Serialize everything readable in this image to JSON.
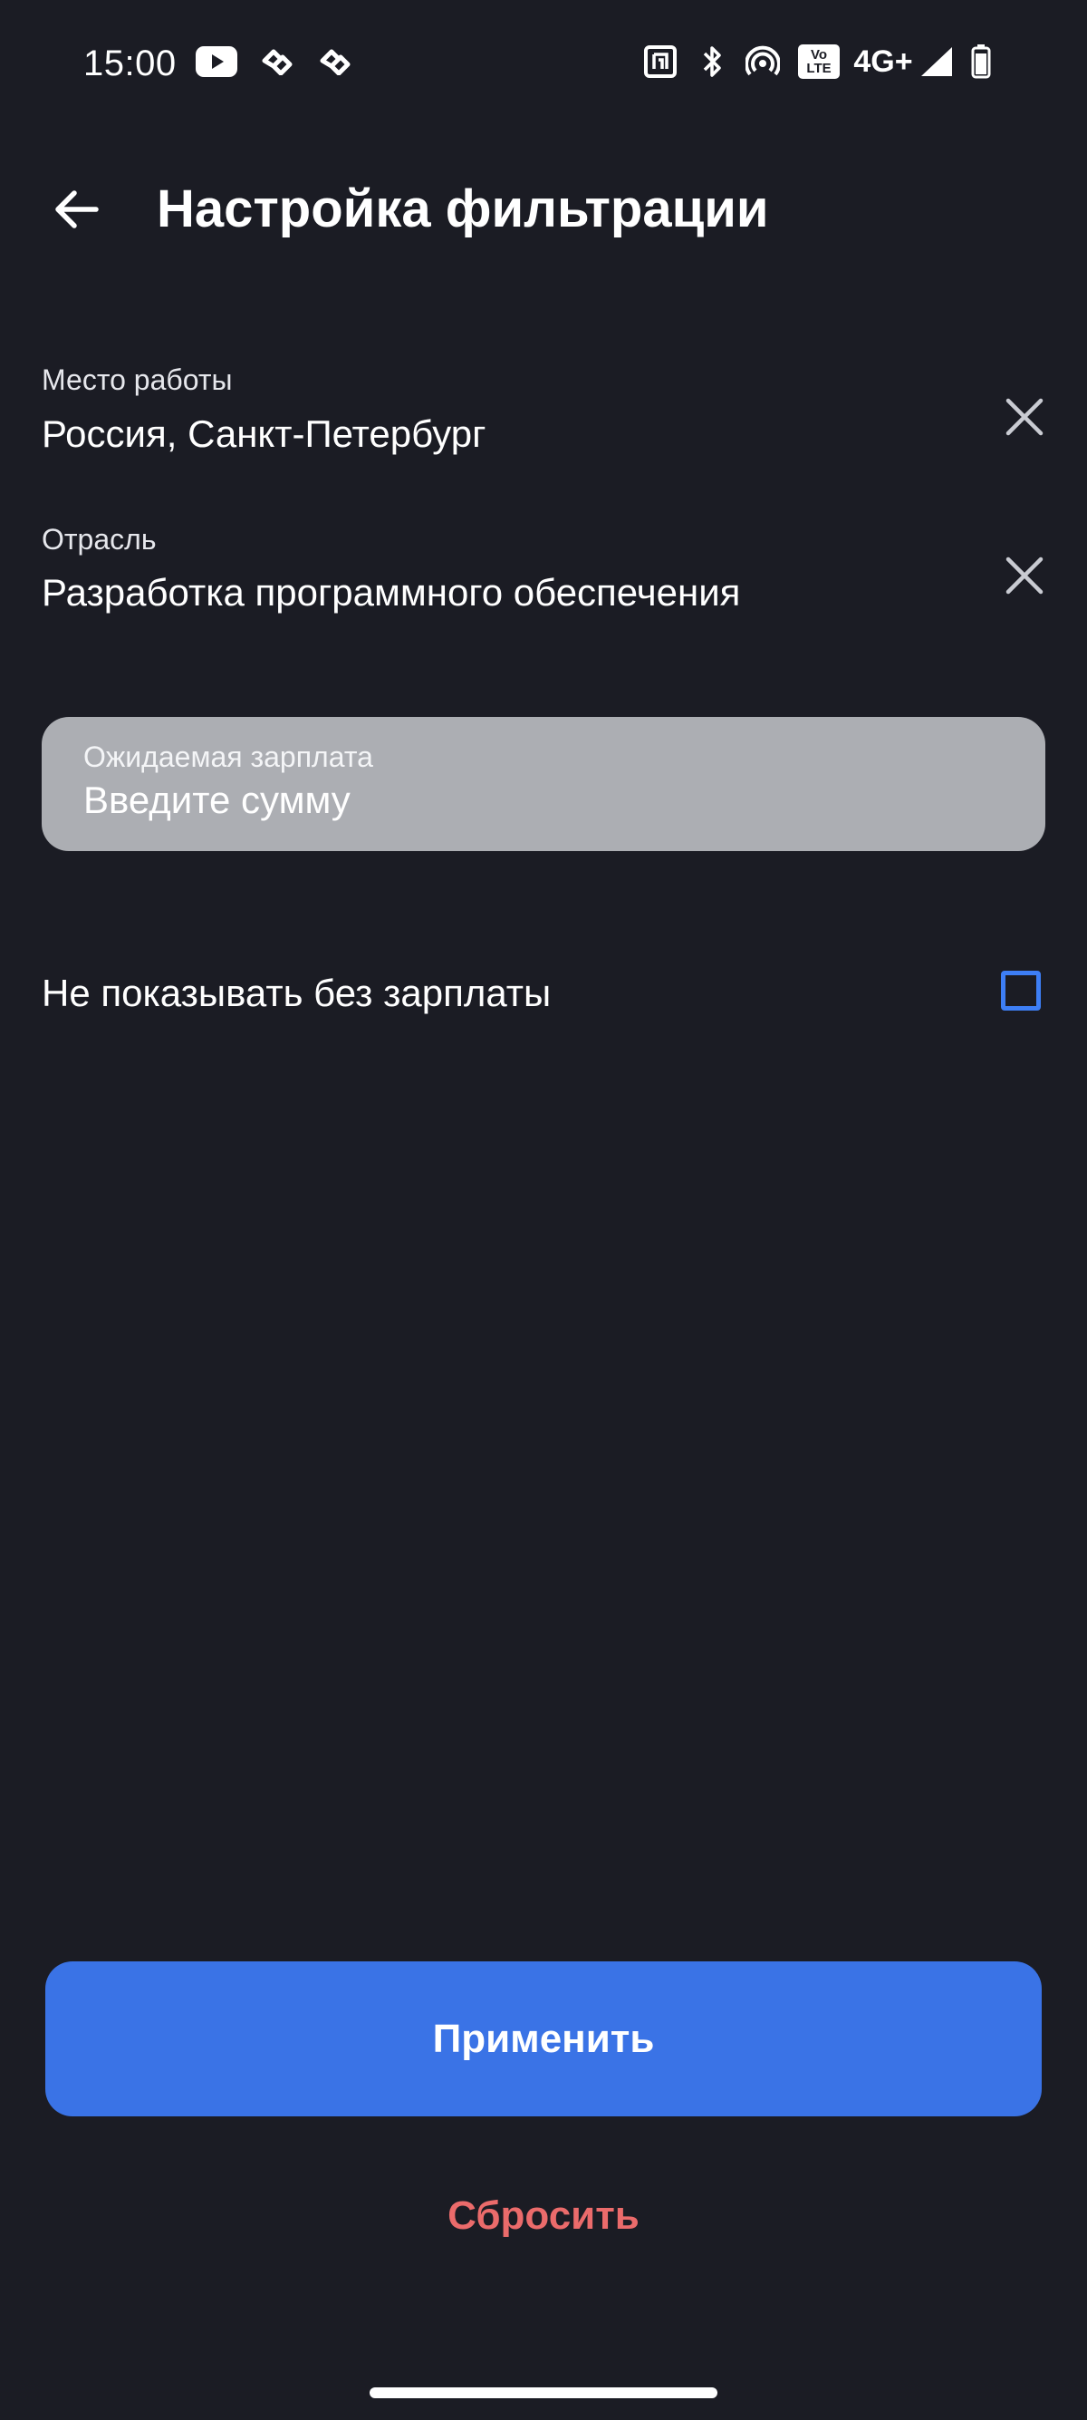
{
  "status_bar": {
    "time": "15:00",
    "network": "4G+",
    "volte_top": "Vo",
    "volte_bottom": "LTE",
    "left_icons": [
      "youtube-icon",
      "notification-icon",
      "notification-icon"
    ],
    "right_icons": [
      "nfc-icon",
      "bluetooth-icon",
      "hotspot-icon",
      "volte-icon",
      "signal-icon",
      "battery-icon"
    ]
  },
  "header": {
    "title": "Настройка фильтрации",
    "back_icon": "arrow-left-icon"
  },
  "filters": {
    "location": {
      "label": "Место работы",
      "value": "Россия, Санкт-Петербург"
    },
    "industry": {
      "label": "Отрасль",
      "value": "Разработка программного обеспечения"
    },
    "salary": {
      "label": "Ожидаемая зарплата",
      "placeholder": "Введите сумму",
      "value": ""
    },
    "hide_without_salary": {
      "label": "Не показывать без зарплаты",
      "checked": false
    }
  },
  "actions": {
    "apply_label": "Применить",
    "reset_label": "Сбросить"
  },
  "colors": {
    "background": "#1b1c24",
    "accent": "#3a73e6",
    "checkbox_border": "#3d7ef5",
    "reset_text": "#eb6b6b",
    "input_background": "#acaeb3"
  }
}
